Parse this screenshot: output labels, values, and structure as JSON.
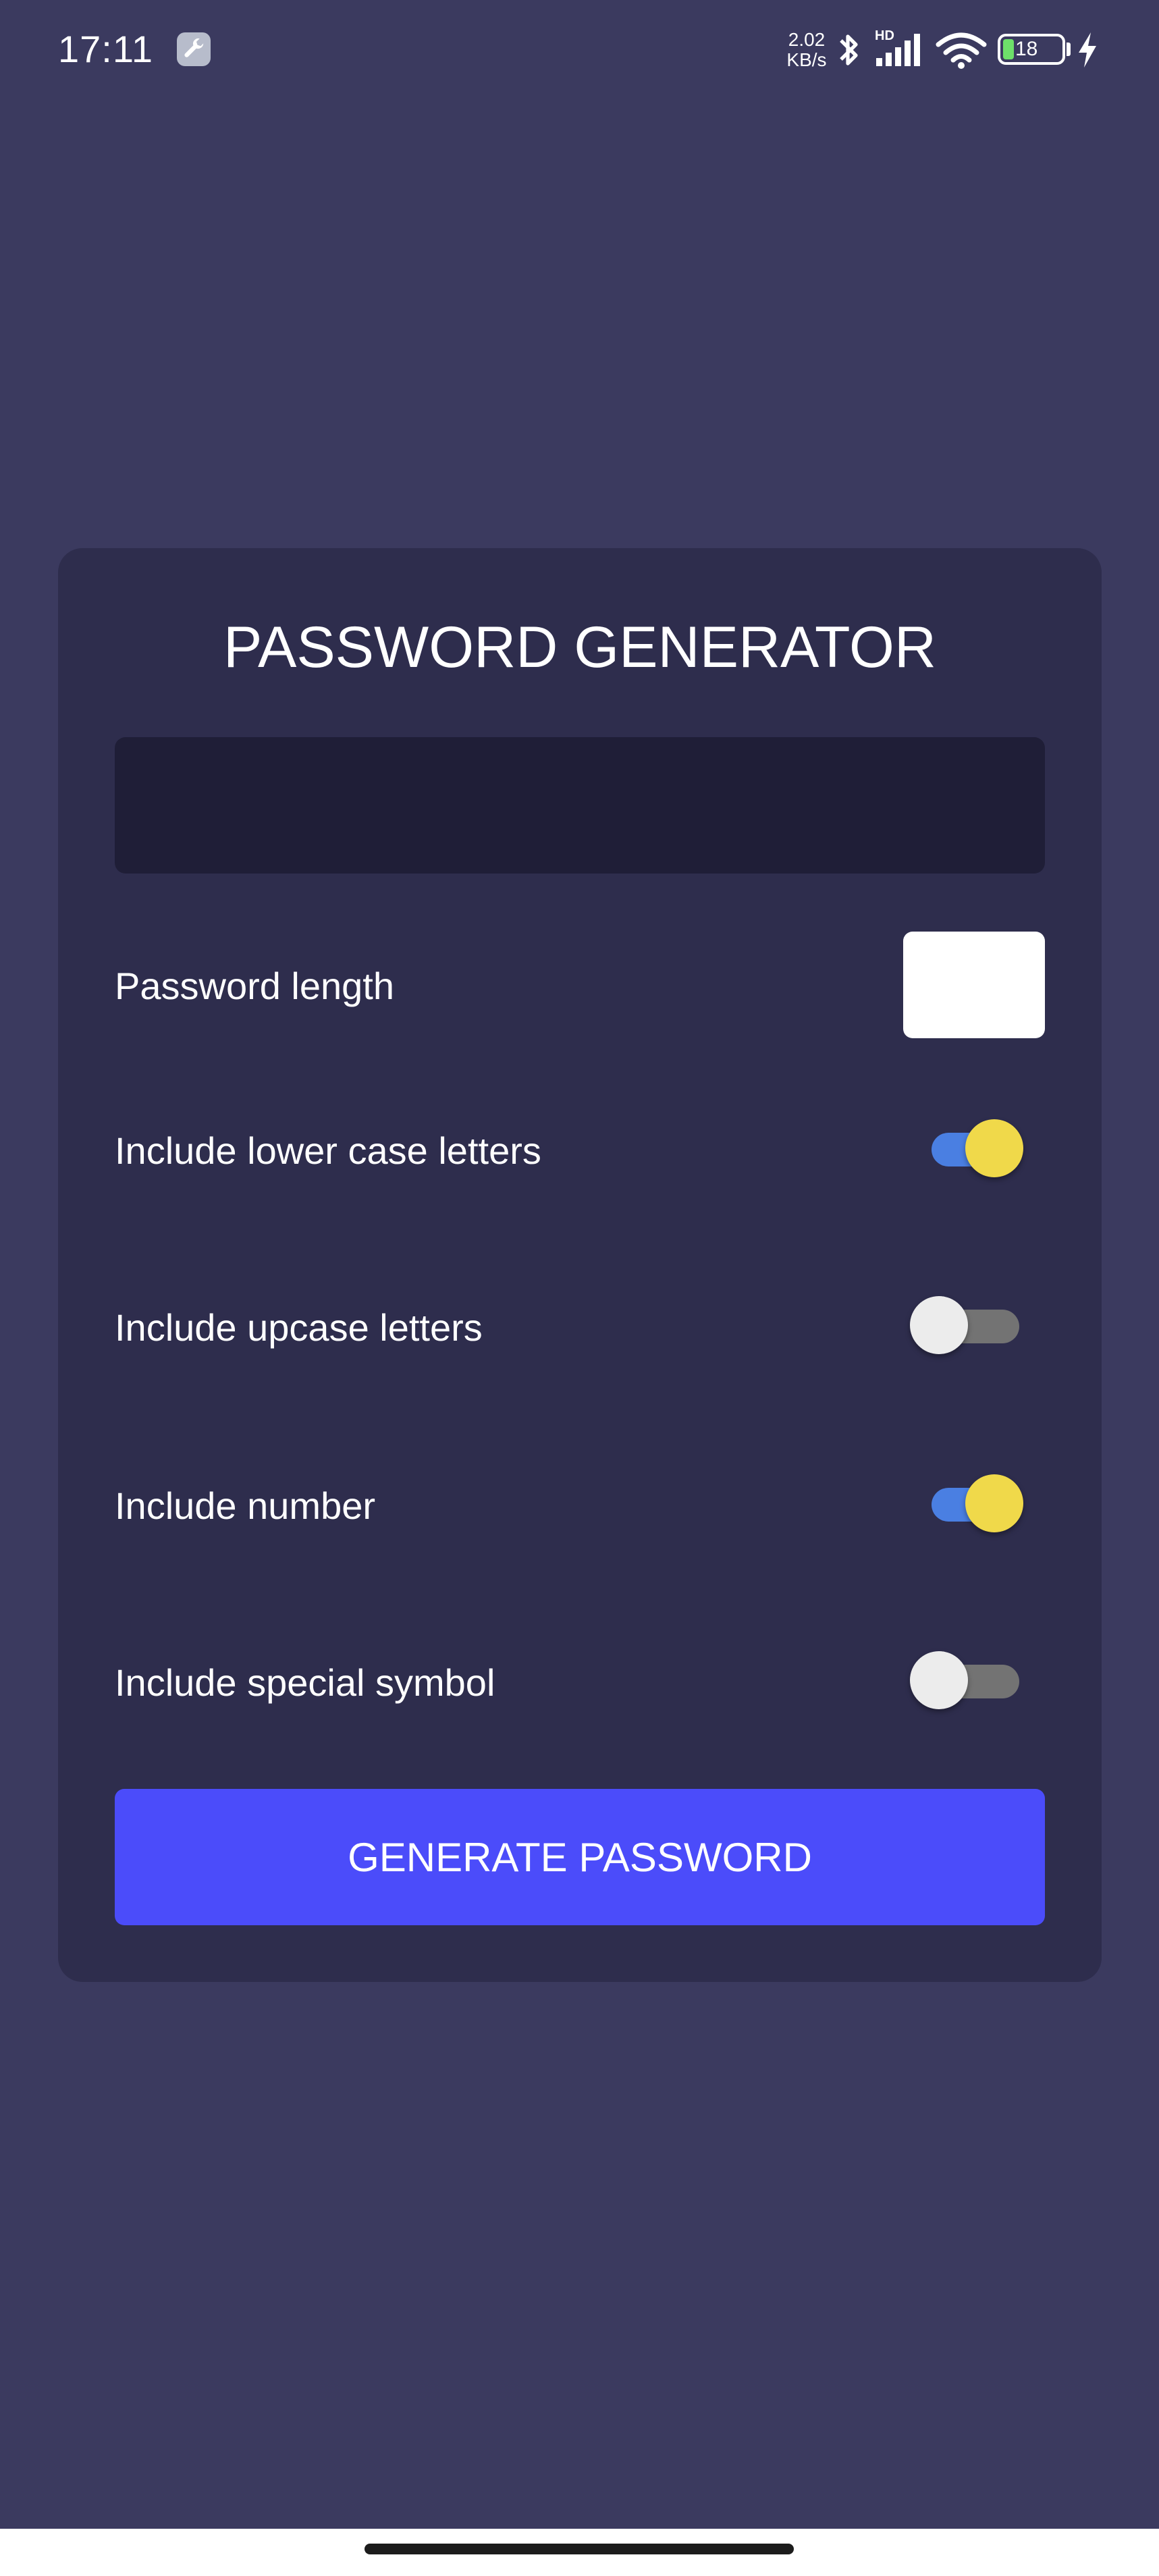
{
  "status_bar": {
    "time": "17:11",
    "net_speed_value": "2.02",
    "net_speed_unit": "KB/s",
    "network_label": "HD",
    "battery_level": "18"
  },
  "card": {
    "title": "PASSWORD GENERATOR",
    "password_value": "",
    "length_label": "Password length",
    "length_value": "",
    "options": [
      {
        "label": "Include lower case letters",
        "checked": true
      },
      {
        "label": "Include upcase letters",
        "checked": false
      },
      {
        "label": "Include number",
        "checked": true
      },
      {
        "label": "Include special symbol",
        "checked": false
      }
    ],
    "generate_label": "GENERATE PASSWORD"
  },
  "colors": {
    "background": "#3b3a5f",
    "card": "#2e2d4d",
    "output_field": "#1f1e37",
    "button": "#4b4cfa",
    "toggle_on_track": "#4a7fe2",
    "toggle_on_thumb": "#f0d94a",
    "toggle_off_track": "#737373",
    "toggle_off_thumb": "#ececec"
  },
  "icons": [
    "wrench-icon",
    "bluetooth-icon",
    "signal-icon",
    "wifi-icon",
    "battery-icon",
    "charging-icon"
  ]
}
